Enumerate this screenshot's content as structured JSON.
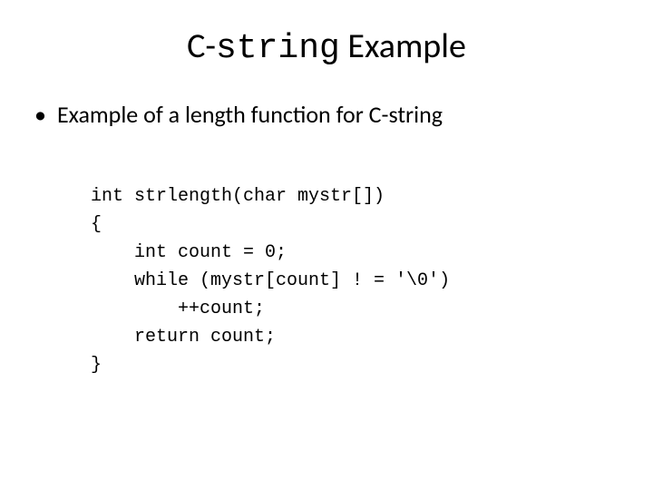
{
  "title": {
    "part1": "C-",
    "mono": "string",
    "part2": " Example"
  },
  "bullet": {
    "dot": "•",
    "text": "Example of a length function for C-string"
  },
  "code": {
    "l1": "int strlength(char mystr[])",
    "l2": "{",
    "l3": "    int count = 0;",
    "l4": "    while (mystr[count] ! = '\\0')",
    "l5": "        ++count;",
    "l6": "    return count;",
    "l7": "}"
  }
}
